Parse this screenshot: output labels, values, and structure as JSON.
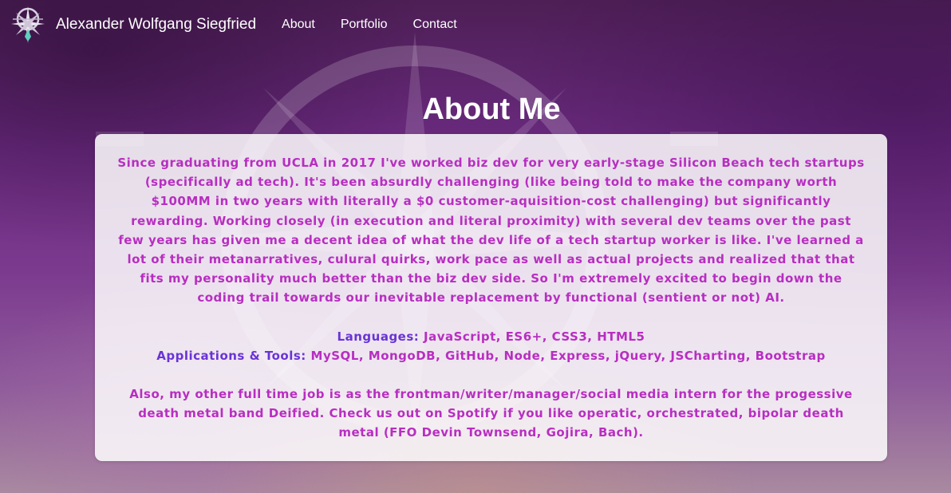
{
  "nav": {
    "brand_name": "Alexander Wolfgang Siegfried",
    "links": [
      {
        "label": "About"
      },
      {
        "label": "Portfolio"
      },
      {
        "label": "Contact"
      }
    ]
  },
  "main": {
    "title": "About Me",
    "intro": "Since graduating from UCLA in 2017 I've worked biz dev for very early-stage Silicon Beach tech startups (specifically ad tech). It's been absurdly challenging (like being told to make the company worth $100MM in two years with literally a $0 customer-aquisition-cost challenging) but significantly rewarding. Working closely (in execution and literal proximity) with several dev teams over the past few years has given me a decent idea of what the dev life of a tech startup worker is like. I've learned a lot of their metanarratives, culural quirks, work pace as well as actual projects and realized that that fits my personality much better than the biz dev side. So I'm extremely excited to begin down the coding trail towards our inevitable replacement by functional (sentient or not) AI.",
    "languages_label": "Languages:",
    "languages_value": " JavaScript, ES6+, CSS3, HTML5",
    "tools_label": "Applications & Tools:",
    "tools_value": " MySQL, MongoDB, GitHub, Node, Express, jQuery, JSCharting, Bootstrap",
    "band_text": "Also, my other full time job is as the frontman/writer/manager/social media intern for the progessive death metal band Deified. Check us out on Spotify if you like operatic, orchestrated, bipolar death metal (FFO Devin Townsend, Gojira, Bach)."
  },
  "colors": {
    "text_accent": "#b82ec1",
    "label_accent": "#6a33d6",
    "nav_text": "#ffffff"
  },
  "icons": {
    "brand_logo": "sigil-logo-icon",
    "background": "sigil-background"
  }
}
